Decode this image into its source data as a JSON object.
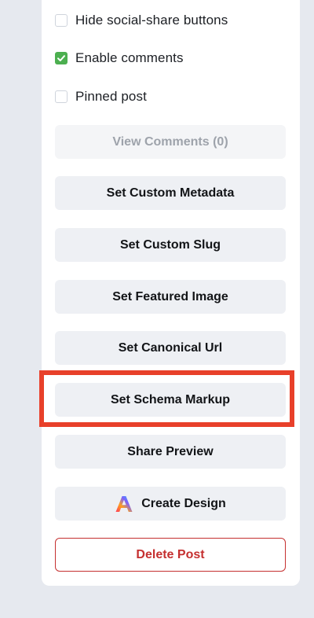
{
  "options": {
    "hide_social_share": {
      "label": "Hide social-share buttons",
      "checked": false
    },
    "enable_comments": {
      "label": "Enable comments",
      "checked": true
    },
    "pinned_post": {
      "label": "Pinned post",
      "checked": false
    }
  },
  "buttons": {
    "view_comments": "View Comments (0)",
    "set_custom_metadata": "Set Custom Metadata",
    "set_custom_slug": "Set Custom Slug",
    "set_featured_image": "Set Featured Image",
    "set_canonical_url": "Set Canonical Url",
    "set_schema_markup": "Set Schema Markup",
    "share_preview": "Share Preview",
    "create_design": "Create Design",
    "delete_post": "Delete Post"
  },
  "icons": {
    "checkmark": "checkmark-icon",
    "create_design": "adobe-express-icon"
  },
  "colors": {
    "highlight": "#e8402a",
    "danger": "#c53030",
    "checkbox_checked": "#4caf50"
  }
}
